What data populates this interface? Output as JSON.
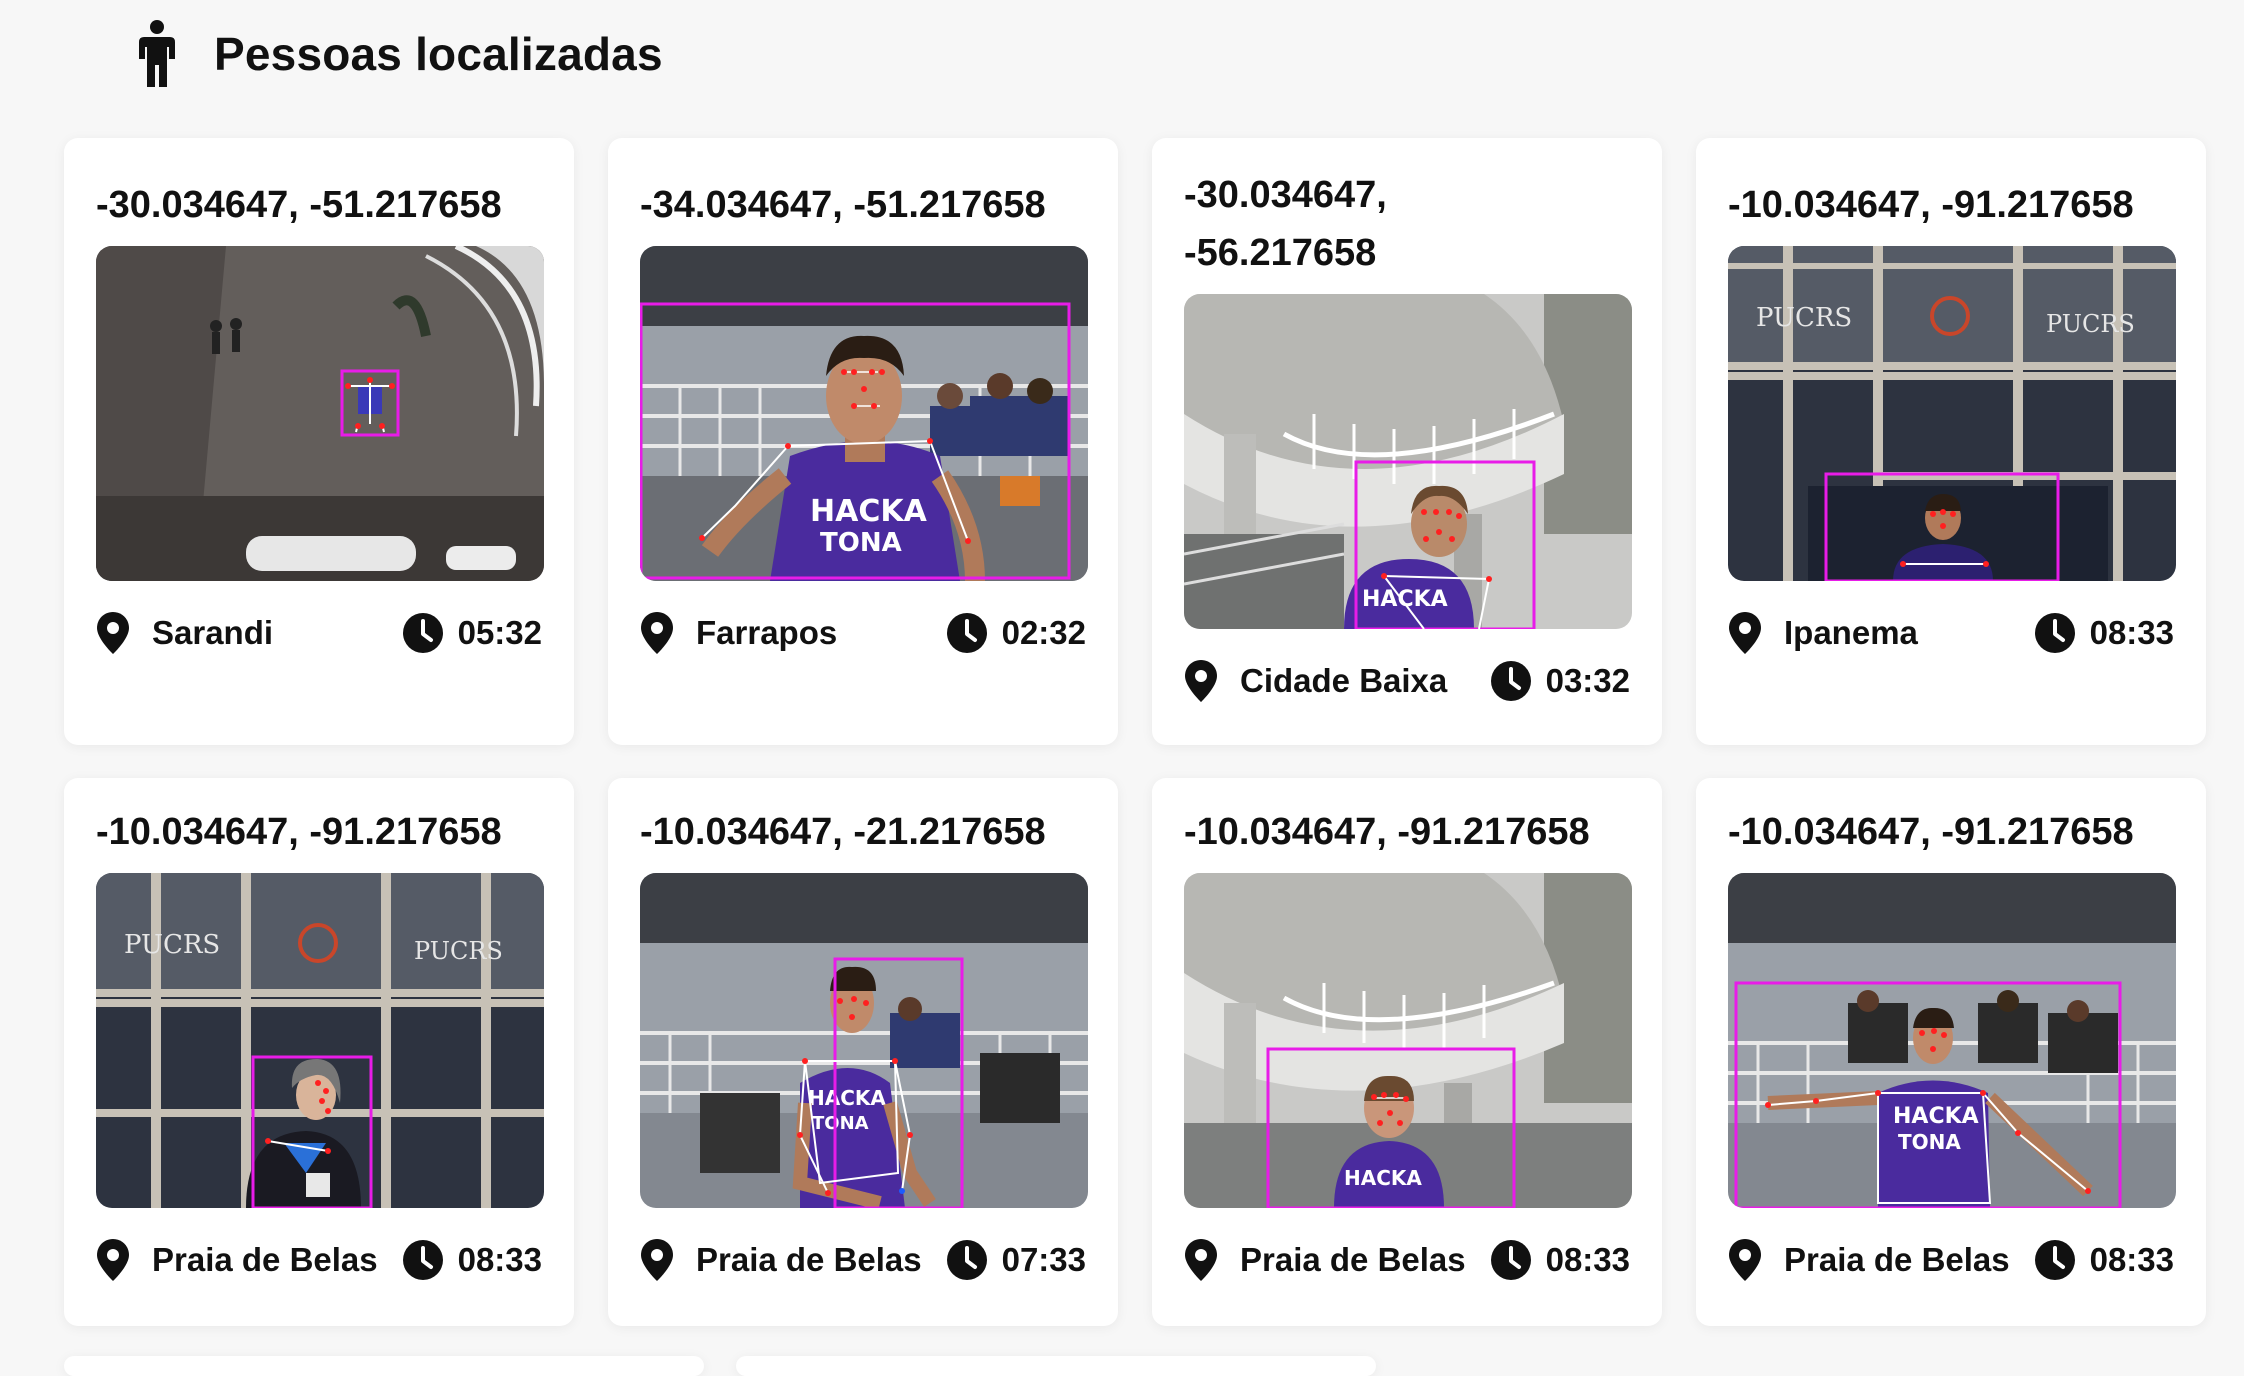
{
  "header": {
    "title": "Pessoas localizadas",
    "icon": "person-icon"
  },
  "cards": [
    {
      "coords": "-30.034647, -51.217658",
      "location": "Sarandi",
      "time": "05:32",
      "scene": "aerial-plaza"
    },
    {
      "coords": "-34.034647, -51.217658",
      "location": "Farrapos",
      "time": "02:32",
      "scene": "office-closeup"
    },
    {
      "coords": "-30.034647, -56.217658",
      "location": "Cidade Baixa",
      "time": "03:32",
      "scene": "spiral-stairs"
    },
    {
      "coords": "-10.034647, -91.217658",
      "location": "Ipanema",
      "time": "08:33",
      "scene": "pucrs-windows"
    },
    {
      "coords": "-10.034647, -91.217658",
      "location": "Praia de Belas",
      "time": "08:33",
      "scene": "pucrs-windows-woman"
    },
    {
      "coords": "-10.034647, -21.217658",
      "location": "Praia de Belas",
      "time": "07:33",
      "scene": "office-seated"
    },
    {
      "coords": "-10.034647, -91.217658",
      "location": "Praia de Belas",
      "time": "08:33",
      "scene": "spiral-stairs-low"
    },
    {
      "coords": "-10.034647, -91.217658",
      "location": "Praia de Belas",
      "time": "08:33",
      "scene": "office-arms-out"
    }
  ],
  "icons": {
    "location": "location-pin-icon",
    "time": "clock-icon"
  },
  "colors": {
    "background": "#f7f7f7",
    "card": "#ffffff",
    "detection_box": "#e81ce8",
    "keypoint": "#ff2020",
    "skeleton": "#ffffff",
    "shirt": "#4a2b9e"
  }
}
